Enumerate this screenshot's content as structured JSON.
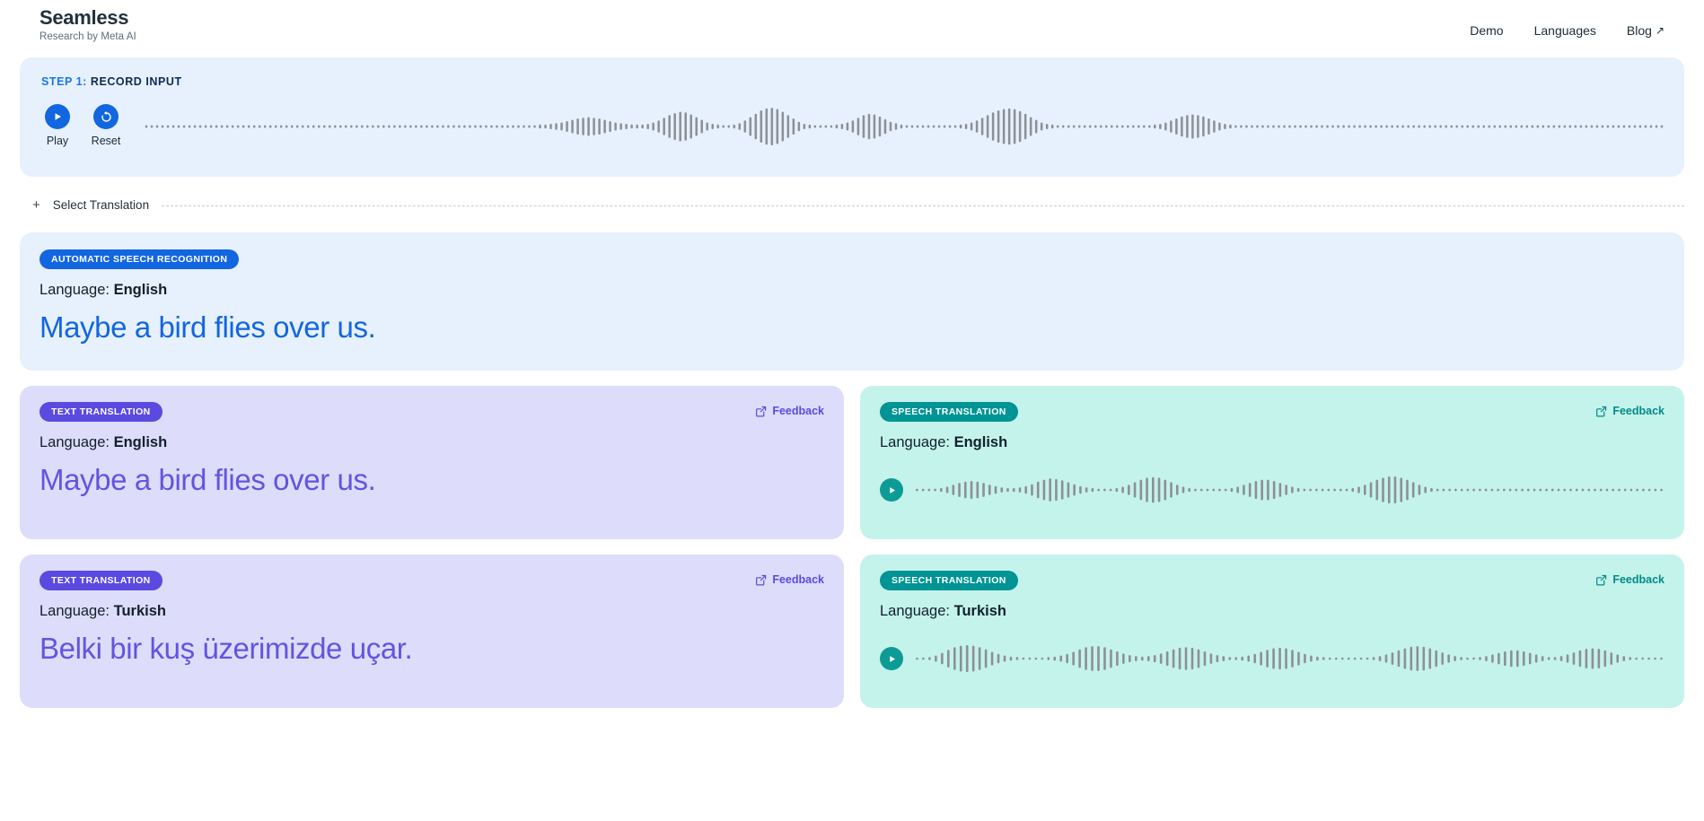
{
  "header": {
    "brand_title": "Seamless",
    "brand_subtitle": "Research by Meta AI",
    "nav": [
      {
        "label": "Demo"
      },
      {
        "label": "Languages"
      },
      {
        "label": "Blog",
        "external": "↗"
      }
    ]
  },
  "record_panel": {
    "step_number": "STEP 1:",
    "step_title": " RECORD INPUT",
    "play_label": "Play",
    "reset_label": "Reset",
    "waveform": [
      2,
      2,
      2,
      2,
      2,
      2,
      2,
      2,
      2,
      2,
      2,
      2,
      2,
      2,
      2,
      2,
      2,
      2,
      2,
      2,
      2,
      2,
      2,
      2,
      2,
      2,
      2,
      2,
      2,
      2,
      2,
      2,
      2,
      2,
      2,
      2,
      2,
      2,
      2,
      2,
      2,
      2,
      2,
      2,
      2,
      2,
      2,
      2,
      2,
      2,
      2,
      2,
      2,
      2,
      2,
      2,
      2,
      2,
      2,
      2,
      2,
      2,
      2,
      2,
      2,
      2,
      2,
      2,
      2,
      2,
      2,
      2,
      2,
      3,
      3,
      4,
      5,
      6,
      8,
      10,
      12,
      13,
      14,
      13,
      12,
      10,
      8,
      6,
      5,
      4,
      3,
      3,
      3,
      4,
      6,
      9,
      13,
      17,
      20,
      22,
      21,
      18,
      14,
      10,
      6,
      4,
      3,
      2,
      2,
      3,
      5,
      9,
      14,
      19,
      24,
      27,
      28,
      26,
      22,
      17,
      12,
      7,
      4,
      3,
      2,
      2,
      2,
      2,
      3,
      4,
      6,
      9,
      13,
      17,
      19,
      18,
      15,
      11,
      7,
      5,
      3,
      2,
      2,
      2,
      2,
      2,
      2,
      2,
      2,
      2,
      2,
      3,
      4,
      6,
      9,
      13,
      17,
      21,
      24,
      26,
      27,
      26,
      23,
      19,
      14,
      10,
      6,
      4,
      3,
      2,
      2,
      2,
      2,
      2,
      2,
      2,
      2,
      2,
      2,
      2,
      2,
      2,
      2,
      2,
      2,
      2,
      2,
      3,
      4,
      6,
      9,
      12,
      15,
      17,
      18,
      17,
      15,
      12,
      9,
      6,
      4,
      3,
      2,
      2,
      2,
      2,
      2,
      2,
      2,
      2,
      2,
      2,
      2,
      2,
      2,
      2,
      2,
      2,
      2,
      2,
      2,
      2,
      2,
      2,
      2,
      2,
      2,
      2,
      2,
      2,
      2,
      2,
      2,
      2,
      2,
      2,
      2,
      2,
      2,
      2,
      2,
      2,
      2,
      2,
      2,
      2,
      2,
      2,
      2,
      2,
      2,
      2,
      2,
      2,
      2,
      2,
      2,
      2,
      2,
      2,
      2,
      2,
      2,
      2,
      2,
      2,
      2,
      2,
      2,
      2,
      2,
      2,
      2,
      2,
      2,
      2,
      2,
      2,
      2,
      2,
      2,
      2
    ]
  },
  "select_translation": {
    "plus": "+",
    "label": "Select Translation"
  },
  "asr": {
    "badge": "AUTOMATIC SPEECH RECOGNITION",
    "language_prefix": "Language: ",
    "language": "English",
    "text": "Maybe a bird flies over us."
  },
  "rows": [
    {
      "text_card": {
        "badge": "TEXT TRANSLATION",
        "feedback": "Feedback",
        "language_prefix": "Language: ",
        "language": "English",
        "text": "Maybe a bird flies over us."
      },
      "speech_card": {
        "badge": "SPEECH TRANSLATION",
        "feedback": "Feedback",
        "language_prefix": "Language: ",
        "language": "English",
        "waveform": [
          2,
          2,
          2,
          2,
          3,
          5,
          8,
          11,
          13,
          14,
          13,
          11,
          8,
          6,
          4,
          3,
          3,
          4,
          6,
          9,
          13,
          16,
          18,
          17,
          15,
          12,
          9,
          6,
          4,
          3,
          2,
          2,
          2,
          3,
          5,
          8,
          12,
          16,
          19,
          20,
          19,
          16,
          12,
          8,
          5,
          3,
          2,
          2,
          2,
          2,
          2,
          2,
          3,
          5,
          8,
          11,
          14,
          16,
          16,
          14,
          11,
          8,
          5,
          3,
          2,
          2,
          2,
          2,
          2,
          2,
          2,
          2,
          3,
          5,
          8,
          12,
          16,
          19,
          21,
          21,
          19,
          16,
          12,
          8,
          5,
          3,
          2,
          2,
          2,
          2,
          2,
          2,
          2,
          2,
          2,
          2,
          2,
          2,
          2,
          2,
          2,
          2,
          2,
          2,
          2,
          2,
          2,
          2,
          2,
          2,
          2,
          2,
          2,
          2,
          2,
          2,
          2,
          2,
          2,
          2,
          2,
          2,
          2,
          2
        ]
      }
    },
    {
      "text_card": {
        "badge": "TEXT TRANSLATION",
        "feedback": "Feedback",
        "language_prefix": "Language: ",
        "language": "Turkish",
        "text": "Belki bir kuş üzerimizde uçar."
      },
      "speech_card": {
        "badge": "SPEECH TRANSLATION",
        "feedback": "Feedback",
        "language_prefix": "Language: ",
        "language": "Turkish",
        "waveform": [
          2,
          2,
          3,
          6,
          11,
          17,
          22,
          25,
          26,
          25,
          22,
          18,
          13,
          9,
          6,
          4,
          3,
          2,
          2,
          2,
          2,
          3,
          4,
          6,
          9,
          13,
          18,
          22,
          24,
          24,
          22,
          18,
          14,
          10,
          7,
          5,
          4,
          5,
          7,
          10,
          14,
          18,
          21,
          22,
          21,
          18,
          14,
          10,
          7,
          5,
          3,
          3,
          4,
          6,
          9,
          13,
          17,
          20,
          21,
          20,
          17,
          13,
          9,
          6,
          4,
          3,
          2,
          2,
          2,
          2,
          2,
          2,
          2,
          3,
          5,
          8,
          12,
          16,
          20,
          23,
          24,
          23,
          20,
          16,
          12,
          8,
          5,
          3,
          2,
          2,
          3,
          5,
          8,
          11,
          14,
          16,
          16,
          14,
          11,
          8,
          5,
          3,
          3,
          5,
          8,
          12,
          16,
          19,
          20,
          19,
          16,
          12,
          8,
          5,
          3,
          2,
          2,
          2,
          2,
          2
        ]
      }
    }
  ],
  "colors": {
    "blue": "#1266e0",
    "purple": "#5b4ae0",
    "teal": "#009494",
    "panel_blue_bg": "#e7f1fd",
    "text_card_bg": "#dedcfb",
    "speech_card_bg": "#c4f3ec",
    "wave_gray": "#8c9096"
  }
}
